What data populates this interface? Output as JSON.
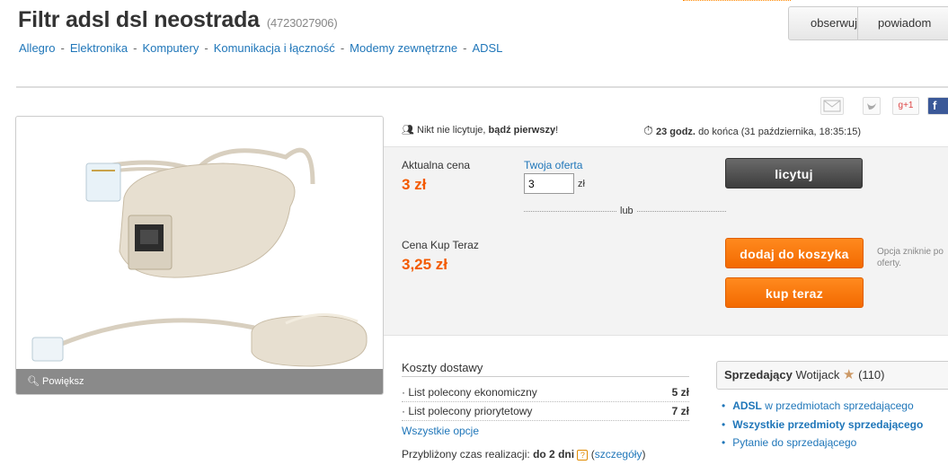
{
  "header": {
    "title": "Filtr adsl dsl neostrada",
    "item_id": "(4723027906)"
  },
  "breadcrumb": [
    "Allegro",
    "Elektronika",
    "Komputery",
    "Komunikacja i łączność",
    "Modemy zewnętrzne",
    "ADSL"
  ],
  "top_buttons": {
    "watch": "obserwuj",
    "notify": "powiadom"
  },
  "share": {
    "gplus": "g+1",
    "fb": "f"
  },
  "photo": {
    "zoom_label": "Powiększ"
  },
  "bids_info": {
    "prefix": "Nikt nie licytuje,",
    "bold": "bądź pierwszy",
    "suffix": "!"
  },
  "timer": {
    "bold": "23 godz.",
    "rest": "do końca (31 października, 18:35:15)"
  },
  "auction": {
    "current_price_label": "Aktualna cena",
    "current_price": "3 zł",
    "your_offer_label": "Twoja oferta",
    "offer_value": "3",
    "currency": "zł",
    "or_label": "lub",
    "bid_button": "licytuj",
    "buy_now_label": "Cena Kup Teraz",
    "buy_now_price": "3,25 zł",
    "add_to_cart_button": "dodaj do koszyka",
    "buy_now_button": "kup teraz",
    "option_note": "Opcja zniknie po oferty."
  },
  "shipping": {
    "title": "Koszty dostawy",
    "rows": [
      {
        "label": "List polecony ekonomiczny",
        "value": "5 zł"
      },
      {
        "label": "List polecony priorytetowy",
        "value": "7 zł"
      }
    ],
    "all_options": "Wszystkie opcje",
    "realization_label": "Przybliżony czas realizacji:",
    "realization_value": "do 2 dni",
    "qmark": "?",
    "details_link": "szczegóły"
  },
  "seller": {
    "label": "Sprzedający",
    "name": "Wotijack",
    "rating": "(110)",
    "links": {
      "adsl_bold": "ADSL",
      "adsl_rest": "w przedmiotach sprzedającego",
      "all_items": "Wszystkie przedmioty sprzedającego",
      "ask": "Pytanie do sprzedającego"
    }
  },
  "colors": {
    "link": "#1f76b9",
    "price": "#f35a00",
    "button_orange": "#f36a00",
    "button_dark": "#3d3d3d"
  }
}
